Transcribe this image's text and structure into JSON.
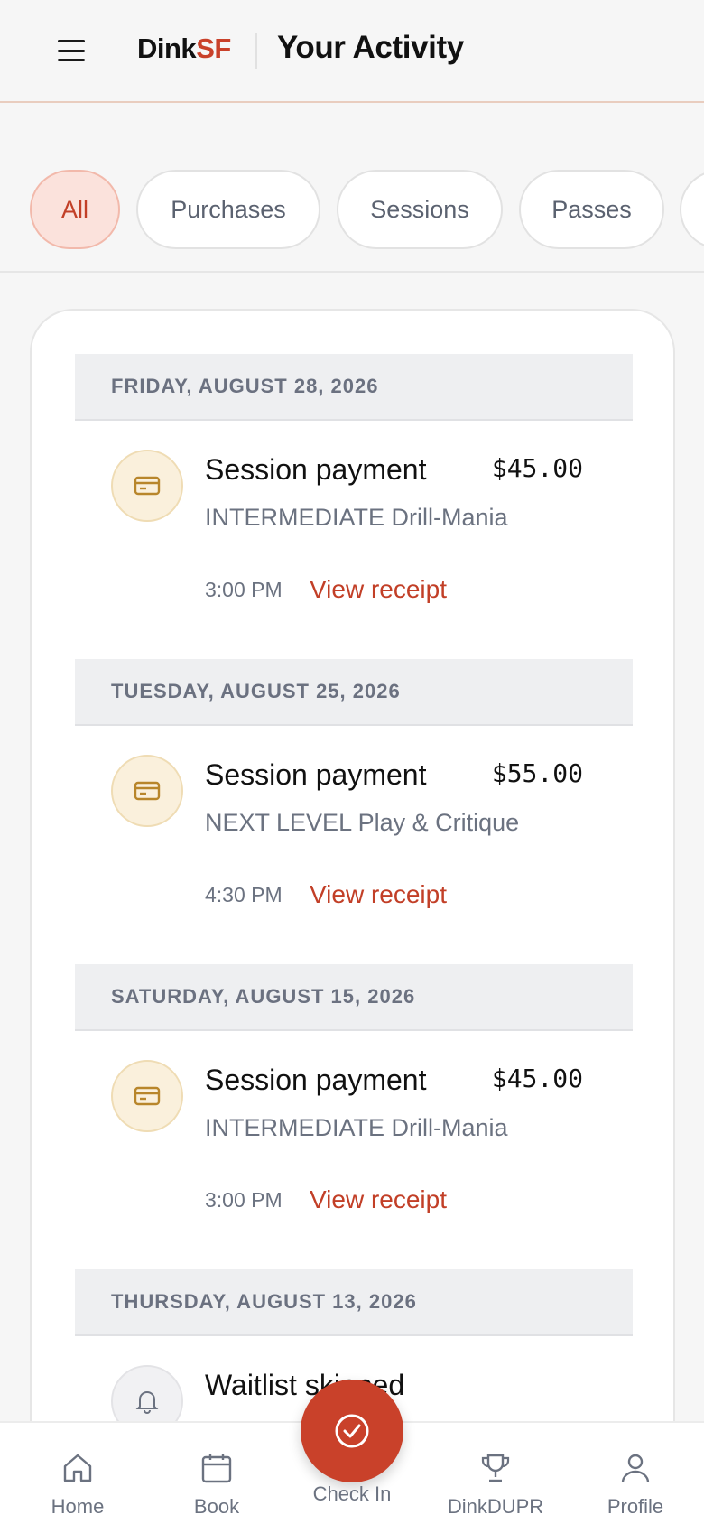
{
  "header": {
    "brand_main": "Dink",
    "brand_accent": "SF",
    "title": "Your Activity",
    "menu_icon": "hamburger-menu-icon"
  },
  "filters": [
    {
      "label": "All",
      "active": true
    },
    {
      "label": "Purchases",
      "active": false
    },
    {
      "label": "Sessions",
      "active": false
    },
    {
      "label": "Passes",
      "active": false
    }
  ],
  "groups": [
    {
      "date": "FRIDAY, AUGUST 28, 2026",
      "item": {
        "icon": "card-icon",
        "title": "Session payment",
        "amount": "$45.00",
        "subtitle": "INTERMEDIATE Drill-Mania",
        "time": "3:00 PM",
        "link": "View receipt"
      }
    },
    {
      "date": "TUESDAY, AUGUST 25, 2026",
      "item": {
        "icon": "card-icon",
        "title": "Session payment",
        "amount": "$55.00",
        "subtitle": "NEXT LEVEL Play & Critique",
        "time": "4:30 PM",
        "link": "View receipt"
      }
    },
    {
      "date": "SATURDAY, AUGUST 15, 2026",
      "item": {
        "icon": "card-icon",
        "title": "Session payment",
        "amount": "$45.00",
        "subtitle": "INTERMEDIATE Drill-Mania",
        "time": "3:00 PM",
        "link": "View receipt"
      }
    },
    {
      "date": "THURSDAY, AUGUST 13, 2026",
      "item": {
        "icon": "bell-icon",
        "title": "Waitlist skipped"
      }
    }
  ],
  "bottom_nav": {
    "home": "Home",
    "book": "Book",
    "checkin": "Check In",
    "dupr": "DinkDUPR",
    "profile": "Profile"
  },
  "colors": {
    "accent": "#c9412a",
    "chip_active_bg": "#fbe2dc",
    "icon_bg": "#faf0dc",
    "date_header_bg": "#eeeff1"
  }
}
